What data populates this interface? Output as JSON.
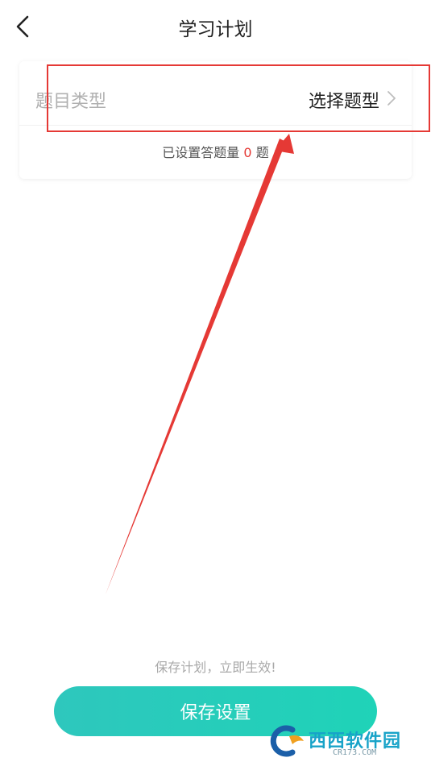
{
  "header": {
    "title": "学习计划",
    "back_icon": "chevron-left-icon"
  },
  "question_type": {
    "label": "题目类型",
    "value": "选择题型",
    "chevron_icon": "chevron-right-icon"
  },
  "count": {
    "prefix": "已设置答题量",
    "value": "0",
    "suffix": "题"
  },
  "footer": {
    "hint": "保存计划，立即生效!",
    "save_label": "保存设置"
  },
  "watermark": {
    "title": "西西软件园",
    "subtitle": "CR173.COM"
  },
  "colors": {
    "accent": "#22cdb9",
    "count_highlight": "#e53935",
    "annotation": "#e53935"
  }
}
